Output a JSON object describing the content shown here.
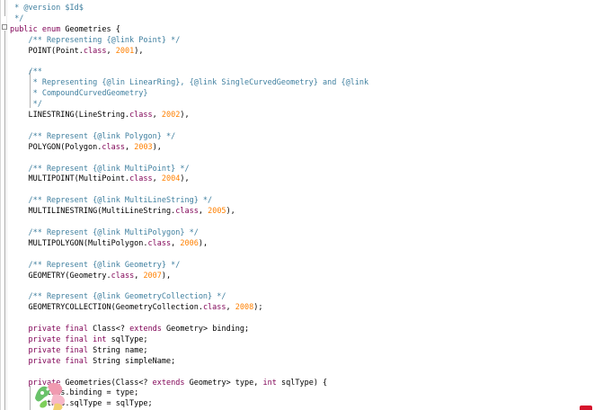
{
  "editor": {
    "lines": [
      [
        {
          "t": " * @version $Id$",
          "c": "cm"
        }
      ],
      [
        {
          "t": " */",
          "c": "cm"
        }
      ],
      [
        {
          "t": "public enum ",
          "c": "kw"
        },
        {
          "t": "Geometries {",
          "c": "plain"
        }
      ],
      [
        {
          "t": "    /** Representing {@link Point} */",
          "c": "cm"
        }
      ],
      [
        {
          "t": "    POINT(Point.",
          "c": "plain"
        },
        {
          "t": "class",
          "c": "kw"
        },
        {
          "t": ", ",
          "c": "plain"
        },
        {
          "t": "2001",
          "c": "num"
        },
        {
          "t": "),",
          "c": "plain"
        }
      ],
      [
        {
          "t": "",
          "c": "plain"
        }
      ],
      [
        {
          "t": "    /**",
          "c": "cm"
        }
      ],
      [
        {
          "t": "     * Representing {@lin LinearRing}, {@link SingleCurvedGeometry} and {@link",
          "c": "cm"
        }
      ],
      [
        {
          "t": "     * CompoundCurvedGeometry}",
          "c": "cm"
        }
      ],
      [
        {
          "t": "     */",
          "c": "cm"
        }
      ],
      [
        {
          "t": "    LINESTRING(LineString.",
          "c": "plain"
        },
        {
          "t": "class",
          "c": "kw"
        },
        {
          "t": ", ",
          "c": "plain"
        },
        {
          "t": "2002",
          "c": "num"
        },
        {
          "t": "),",
          "c": "plain"
        }
      ],
      [
        {
          "t": "",
          "c": "plain"
        }
      ],
      [
        {
          "t": "    /** Represent {@link Polygon} */",
          "c": "cm"
        }
      ],
      [
        {
          "t": "    POLYGON(Polygon.",
          "c": "plain"
        },
        {
          "t": "class",
          "c": "kw"
        },
        {
          "t": ", ",
          "c": "plain"
        },
        {
          "t": "2003",
          "c": "num"
        },
        {
          "t": "),",
          "c": "plain"
        }
      ],
      [
        {
          "t": "",
          "c": "plain"
        }
      ],
      [
        {
          "t": "    /** Represent {@link MultiPoint} */",
          "c": "cm"
        }
      ],
      [
        {
          "t": "    MULTIPOINT(MultiPoint.",
          "c": "plain"
        },
        {
          "t": "class",
          "c": "kw"
        },
        {
          "t": ", ",
          "c": "plain"
        },
        {
          "t": "2004",
          "c": "num"
        },
        {
          "t": "),",
          "c": "plain"
        }
      ],
      [
        {
          "t": "",
          "c": "plain"
        }
      ],
      [
        {
          "t": "    /** Represent {@link MultiLineString} */",
          "c": "cm"
        }
      ],
      [
        {
          "t": "    MULTILINESTRING(MultiLineString.",
          "c": "plain"
        },
        {
          "t": "class",
          "c": "kw"
        },
        {
          "t": ", ",
          "c": "plain"
        },
        {
          "t": "2005",
          "c": "num"
        },
        {
          "t": "),",
          "c": "plain"
        }
      ],
      [
        {
          "t": "",
          "c": "plain"
        }
      ],
      [
        {
          "t": "    /** Represent {@link MultiPolygon} */",
          "c": "cm"
        }
      ],
      [
        {
          "t": "    MULTIPOLYGON(MultiPolygon.",
          "c": "plain"
        },
        {
          "t": "class",
          "c": "kw"
        },
        {
          "t": ", ",
          "c": "plain"
        },
        {
          "t": "2006",
          "c": "num"
        },
        {
          "t": "),",
          "c": "plain"
        }
      ],
      [
        {
          "t": "",
          "c": "plain"
        }
      ],
      [
        {
          "t": "    /** Represent {@link Geometry} */",
          "c": "cm"
        }
      ],
      [
        {
          "t": "    GEOMETRY(Geometry.",
          "c": "plain"
        },
        {
          "t": "class",
          "c": "kw"
        },
        {
          "t": ", ",
          "c": "plain"
        },
        {
          "t": "2007",
          "c": "num"
        },
        {
          "t": "),",
          "c": "plain"
        }
      ],
      [
        {
          "t": "",
          "c": "plain"
        }
      ],
      [
        {
          "t": "    /** Represent {@link GeometryCollection} */",
          "c": "cm"
        }
      ],
      [
        {
          "t": "    GEOMETRYCOLLECTION(GeometryCollection.",
          "c": "plain"
        },
        {
          "t": "class",
          "c": "kw"
        },
        {
          "t": ", ",
          "c": "plain"
        },
        {
          "t": "2008",
          "c": "num"
        },
        {
          "t": ");",
          "c": "plain"
        }
      ],
      [
        {
          "t": "",
          "c": "plain"
        }
      ],
      [
        {
          "t": "    ",
          "c": "plain"
        },
        {
          "t": "private final ",
          "c": "kw"
        },
        {
          "t": "Class<? ",
          "c": "plain"
        },
        {
          "t": "extends ",
          "c": "kw"
        },
        {
          "t": "Geometry> binding;",
          "c": "plain"
        }
      ],
      [
        {
          "t": "    ",
          "c": "plain"
        },
        {
          "t": "private final int ",
          "c": "kw"
        },
        {
          "t": "sqlType;",
          "c": "plain"
        }
      ],
      [
        {
          "t": "    ",
          "c": "plain"
        },
        {
          "t": "private final ",
          "c": "kw"
        },
        {
          "t": "String name;",
          "c": "plain"
        }
      ],
      [
        {
          "t": "    ",
          "c": "plain"
        },
        {
          "t": "private final ",
          "c": "kw"
        },
        {
          "t": "String simpleName;",
          "c": "plain"
        }
      ],
      [
        {
          "t": "",
          "c": "plain"
        }
      ],
      [
        {
          "t": "    ",
          "c": "plain"
        },
        {
          "t": "private ",
          "c": "kw"
        },
        {
          "t": "Geometries(Class<? ",
          "c": "plain"
        },
        {
          "t": "extends ",
          "c": "kw"
        },
        {
          "t": "Geometry> type, ",
          "c": "plain"
        },
        {
          "t": "int ",
          "c": "kw"
        },
        {
          "t": "sqlType) {",
          "c": "plain"
        }
      ],
      [
        {
          "t": "        this.binding = type;",
          "c": "plain"
        }
      ],
      [
        {
          "t": "        this.sqlType = sqlType;",
          "c": "plain"
        }
      ]
    ]
  },
  "colors": {
    "comment": "#3f7f9f",
    "keyword": "#7f0055",
    "number": "#ff8000",
    "text": "#000000"
  }
}
